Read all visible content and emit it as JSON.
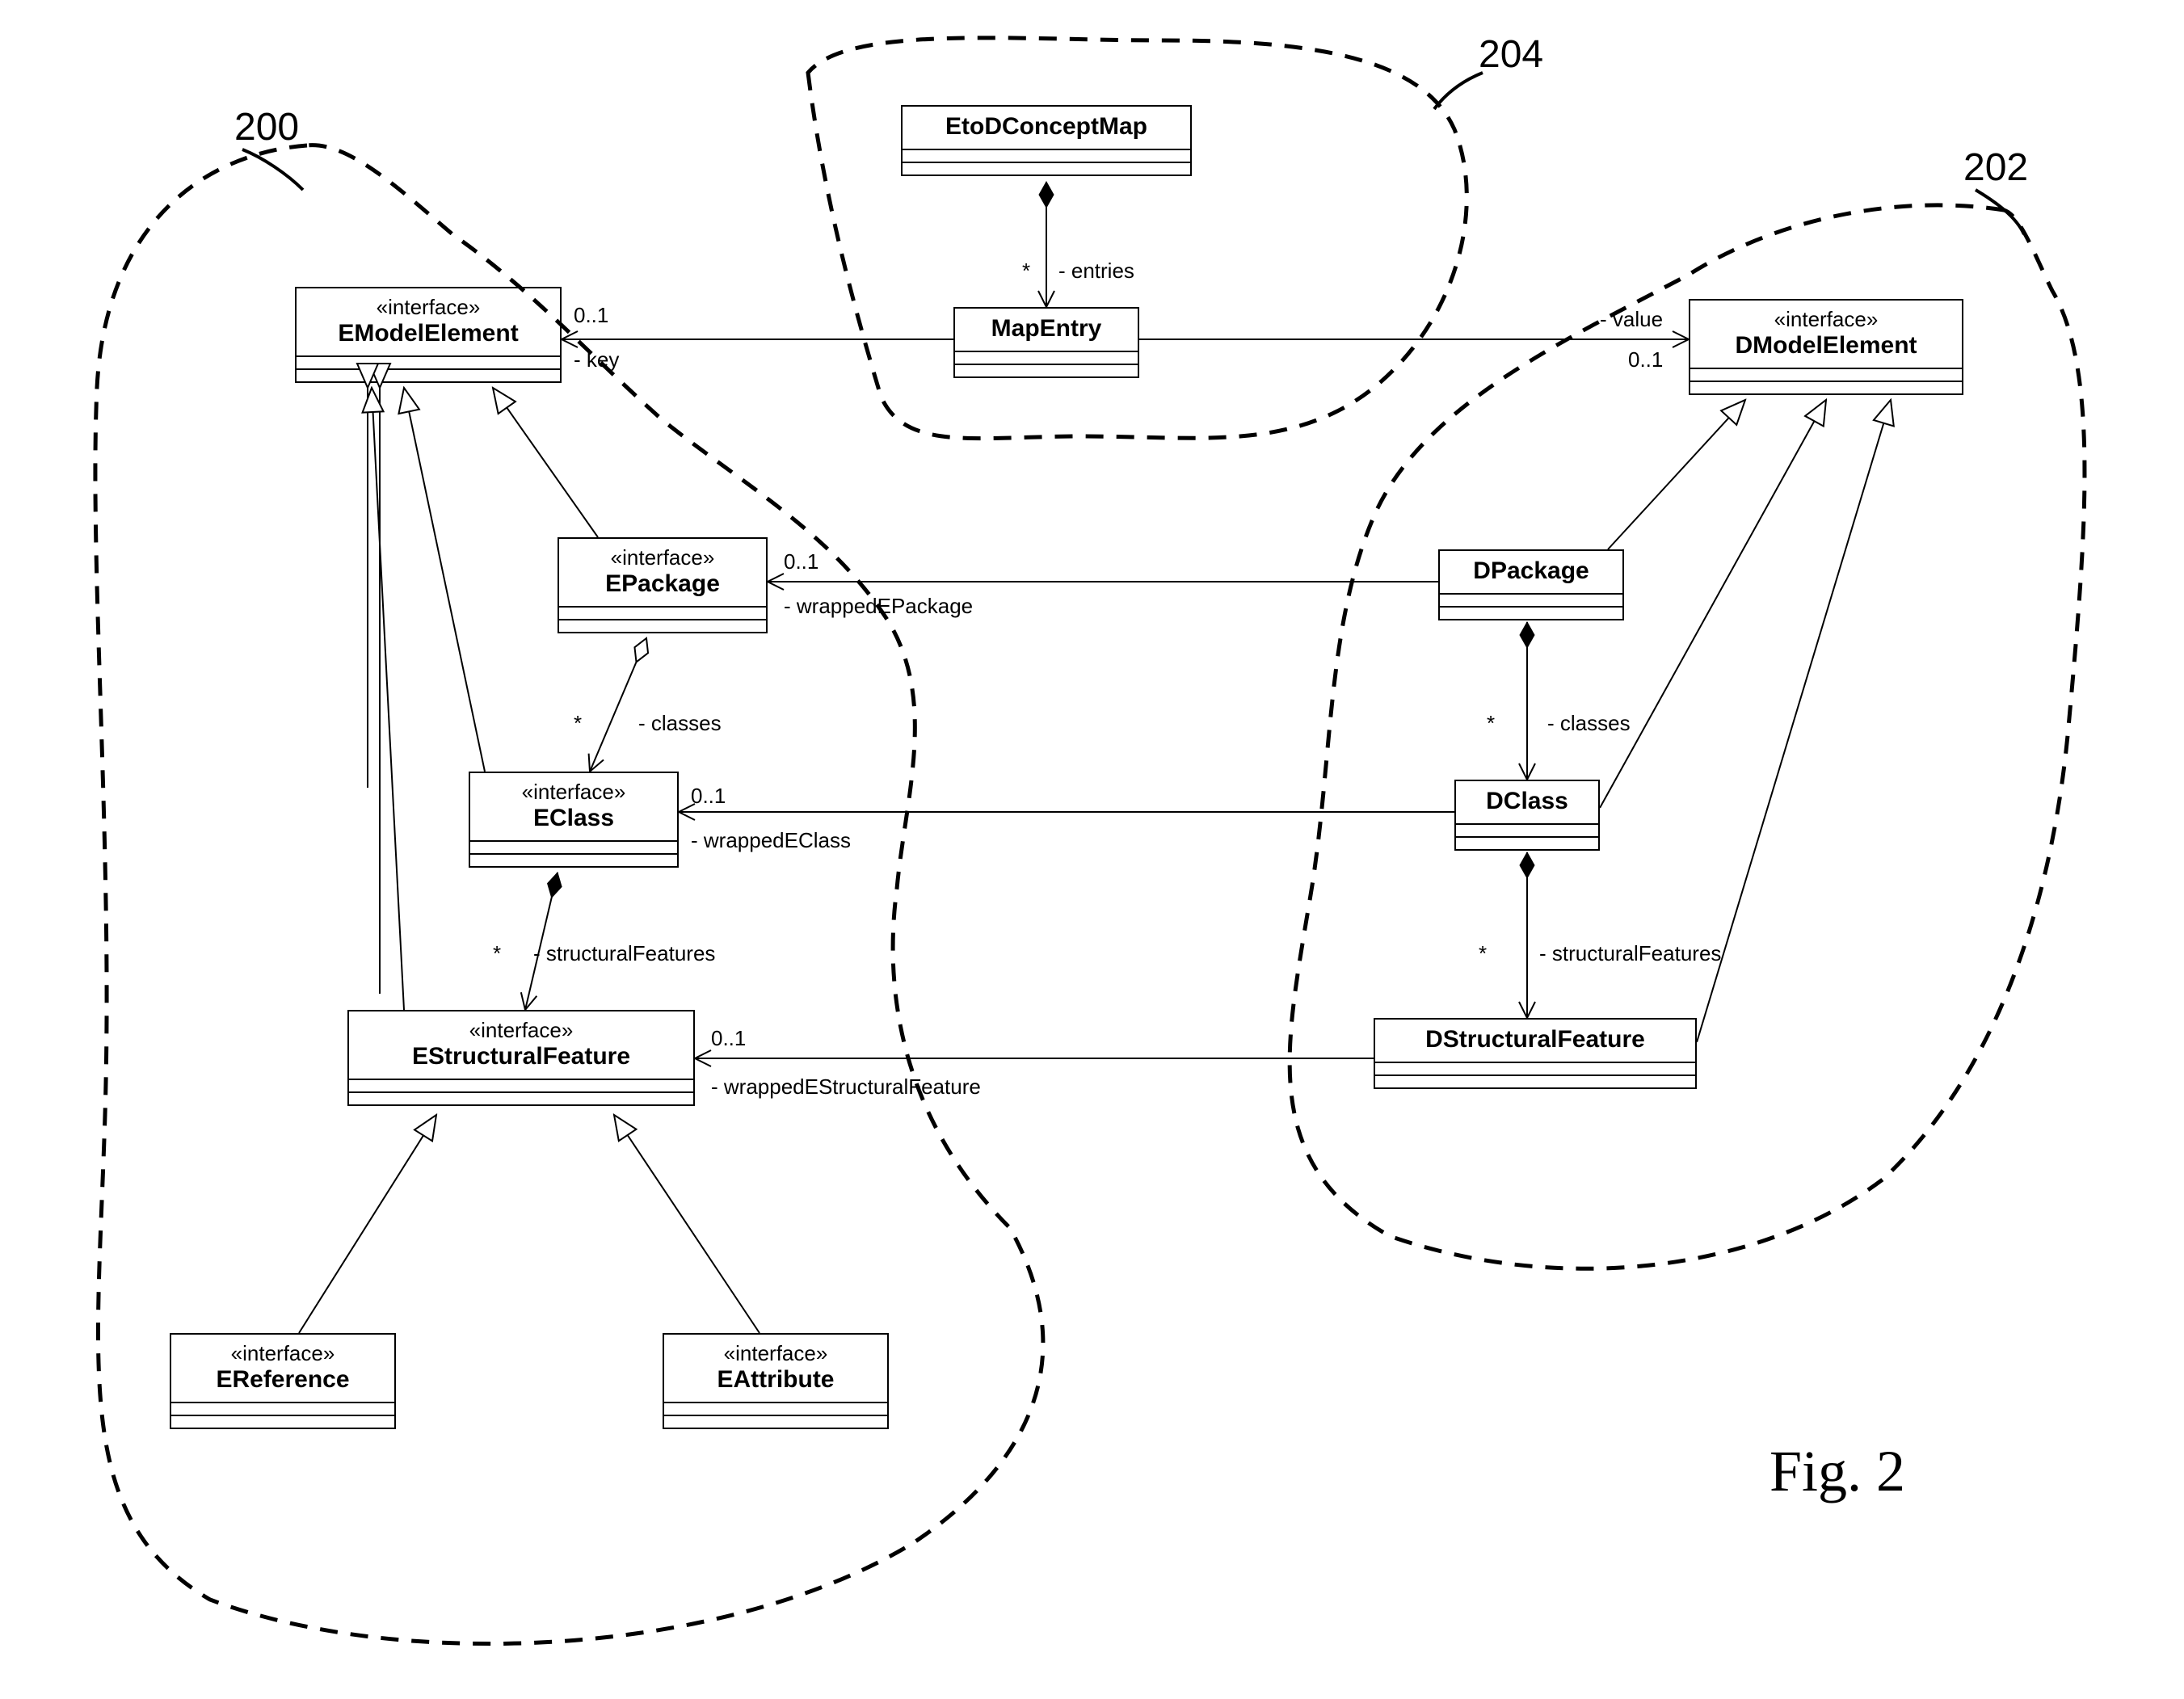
{
  "figure_label": "Fig. 2",
  "regions": {
    "left": "200",
    "right": "202",
    "top": "204"
  },
  "boxes": {
    "emodel": {
      "stereo": "«interface»",
      "name": "EModelElement"
    },
    "epkg": {
      "stereo": "«interface»",
      "name": "EPackage"
    },
    "eclass": {
      "stereo": "«interface»",
      "name": "EClass"
    },
    "esf": {
      "stereo": "«interface»",
      "name": "EStructuralFeature"
    },
    "eref": {
      "stereo": "«interface»",
      "name": "EReference"
    },
    "eattr": {
      "stereo": "«interface»",
      "name": "EAttribute"
    },
    "etod": {
      "name": "EtoDConceptMap"
    },
    "mapentry": {
      "name": "MapEntry"
    },
    "dmodel": {
      "stereo": "«interface»",
      "name": "DModelElement"
    },
    "dpkg": {
      "name": "DPackage"
    },
    "dclass": {
      "name": "DClass"
    },
    "dsf": {
      "name": "DStructuralFeature"
    }
  },
  "labels": {
    "key_mult": "0..1",
    "key": "- key",
    "value": "- value",
    "value_mult": "0..1",
    "entries_star": "*",
    "entries": "- entries",
    "wEPkg_mult": "0..1",
    "wEPkg": "- wrappedEPackage",
    "wEClass_mult": "0..1",
    "wEClass": "- wrappedEClass",
    "wESF_mult": "0..1",
    "wESF": "- wrappedEStructuralFeature",
    "e_cls_star": "*",
    "e_cls": "- classes",
    "e_sf_star": "*",
    "e_sf": "- structuralFeatures",
    "d_cls_star": "*",
    "d_cls": "- classes",
    "d_sf_star": "*",
    "d_sf": "- structuralFeatures"
  }
}
